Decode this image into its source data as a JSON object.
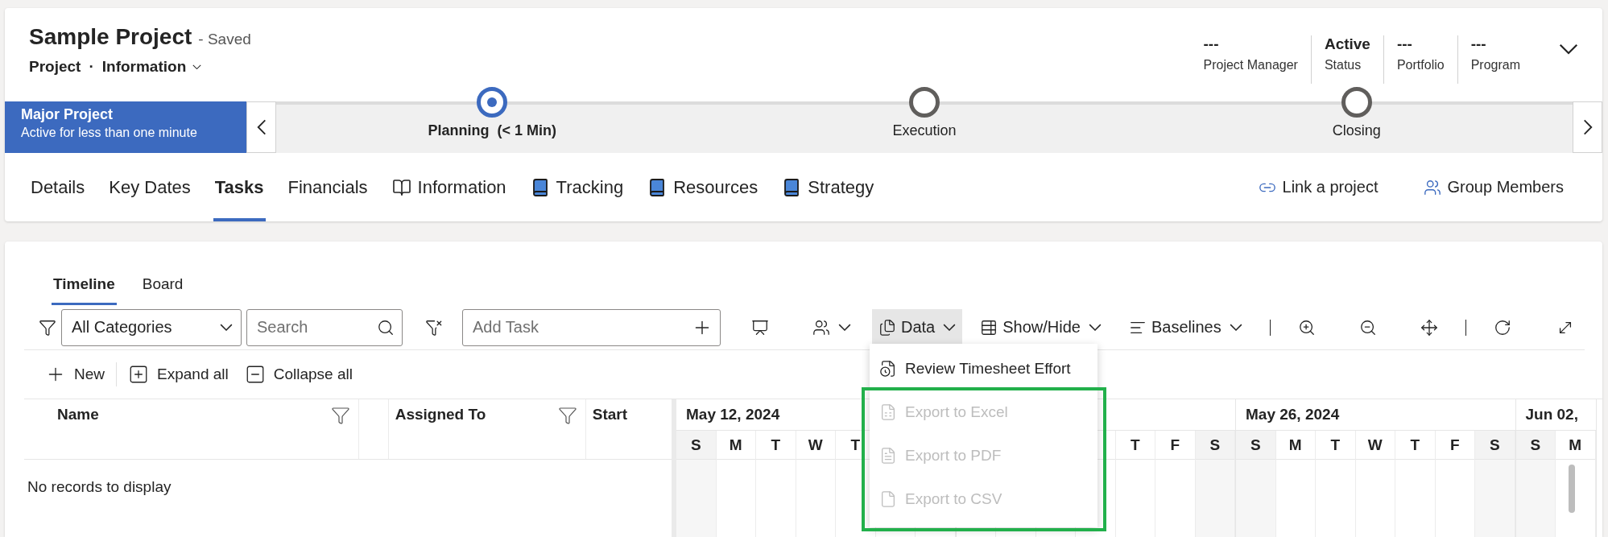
{
  "header": {
    "title": "Sample Project",
    "save_status": "- Saved",
    "entity": "Project",
    "separator": "·",
    "form": "Information",
    "fields": [
      {
        "value": "---",
        "label": "Project Manager"
      },
      {
        "value": "Active",
        "label": "Status"
      },
      {
        "value": "---",
        "label": "Portfolio"
      },
      {
        "value": "---",
        "label": "Program"
      }
    ]
  },
  "process": {
    "name": "Major Project",
    "duration": "Active for less than one minute",
    "stages": [
      {
        "name": "Planning",
        "time": "(< 1 Min)",
        "selected": true
      },
      {
        "name": "Execution",
        "selected": false
      },
      {
        "name": "Closing",
        "selected": false
      }
    ]
  },
  "tabs": [
    {
      "label": "Details",
      "kind": "text",
      "selected": false
    },
    {
      "label": "Key Dates",
      "kind": "text",
      "selected": false
    },
    {
      "label": "Tasks",
      "kind": "text",
      "selected": true
    },
    {
      "label": "Financials",
      "kind": "text",
      "selected": false
    },
    {
      "label": "Information",
      "kind": "book-outline",
      "selected": false
    },
    {
      "label": "Tracking",
      "kind": "book",
      "selected": false
    },
    {
      "label": "Resources",
      "kind": "book",
      "selected": false
    },
    {
      "label": "Strategy",
      "kind": "book",
      "selected": false
    }
  ],
  "actions": [
    {
      "label": "Link a project",
      "kind": "link"
    },
    {
      "label": "Group Members",
      "kind": "people"
    }
  ],
  "subtabs": [
    {
      "label": "Timeline",
      "selected": true
    },
    {
      "label": "Board",
      "selected": false
    }
  ],
  "toolbar": {
    "category": "All Categories",
    "search_placeholder": "Search",
    "add_task_placeholder": "Add Task",
    "buttons": [
      {
        "kind": "board"
      },
      {
        "kind": "people",
        "caret": true
      },
      {
        "kind": "data",
        "label": "Data",
        "caret": true,
        "open": true
      },
      {
        "kind": "showhide",
        "label": "Show/Hide",
        "caret": true
      },
      {
        "kind": "baselines",
        "label": "Baselines",
        "caret": true
      },
      {
        "kind": "divider"
      },
      {
        "kind": "zoom-in"
      },
      {
        "kind": "zoom-out"
      },
      {
        "kind": "fit"
      },
      {
        "kind": "divider"
      },
      {
        "kind": "refresh"
      },
      {
        "kind": "fullscreen"
      }
    ]
  },
  "menu": {
    "items": [
      {
        "label": "Review Timesheet Effort",
        "kind": "timesheet",
        "disabled": false,
        "highlighted": false
      },
      {
        "label": "Export to Excel",
        "kind": "excel",
        "disabled": true,
        "highlighted": true
      },
      {
        "label": "Export to PDF",
        "kind": "pdf",
        "disabled": true,
        "highlighted": true
      },
      {
        "label": "Export to CSV",
        "kind": "csv",
        "disabled": true,
        "highlighted": true
      }
    ]
  },
  "commands": [
    {
      "kind": "new",
      "label": "New"
    },
    {
      "kind": "expand",
      "label": "Expand all"
    },
    {
      "kind": "collapse",
      "label": "Collapse all"
    }
  ],
  "grid": {
    "columns": [
      {
        "kind": "text",
        "label": "Name",
        "filter": true
      },
      {
        "kind": "blank"
      },
      {
        "kind": "text",
        "label": "Assigned To",
        "filter": true
      },
      {
        "kind": "text",
        "label": "Start",
        "filter": false
      }
    ],
    "empty_message": "No records to display"
  },
  "timeline": {
    "weeks": [
      {
        "label": "May 12, 2024",
        "covered_at_start": false,
        "covered_at_end": true,
        "days": [
          {
            "letter": "S",
            "weekend": true
          },
          {
            "letter": "M",
            "weekend": false
          },
          {
            "letter": "T",
            "weekend": false
          },
          {
            "letter": "W",
            "weekend": false
          },
          {
            "letter": "T",
            "weekend": false
          }
        ]
      },
      {
        "covered_at_start": true,
        "covered_at_end": false,
        "days": [
          {
            "letter": "T",
            "weekend": false
          },
          {
            "letter": "F",
            "weekend": false
          },
          {
            "letter": "S",
            "weekend": true
          }
        ]
      },
      {
        "label": "May 26, 2024",
        "covered_at_start": false,
        "covered_at_end": false,
        "days": [
          {
            "letter": "S",
            "weekend": true
          },
          {
            "letter": "M",
            "weekend": false
          },
          {
            "letter": "T",
            "weekend": false
          },
          {
            "letter": "W",
            "weekend": false
          },
          {
            "letter": "T",
            "weekend": false
          },
          {
            "letter": "F",
            "weekend": false
          },
          {
            "letter": "S",
            "weekend": true
          }
        ]
      },
      {
        "label": "Jun 02,",
        "covered_at_start": false,
        "covered_at_end": false,
        "days": [
          {
            "letter": "S",
            "weekend": true
          },
          {
            "letter": "M",
            "weekend": false
          }
        ]
      }
    ]
  }
}
